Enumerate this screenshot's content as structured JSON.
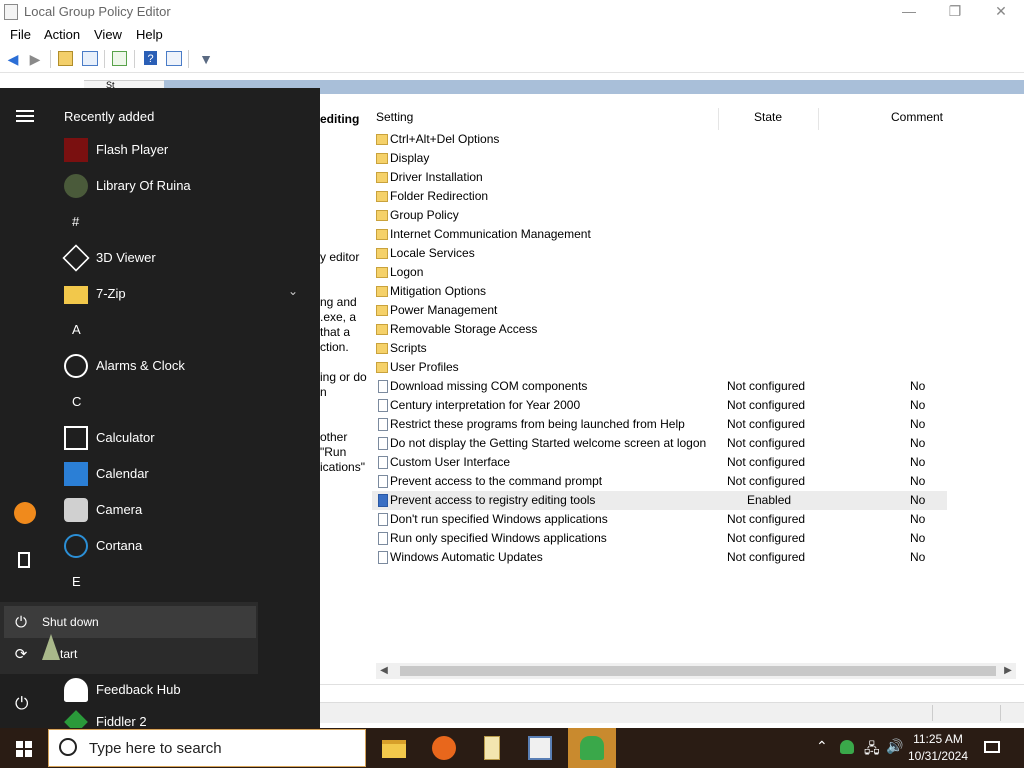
{
  "window": {
    "title": "Local Group Policy Editor",
    "minimize": "—",
    "maximize": "❐",
    "close": "✕"
  },
  "menu": [
    "File",
    "Action",
    "View",
    "Help"
  ],
  "left_pane": {
    "tree_partial": "St",
    "header_partial": "editing",
    "desc_lines": [
      "y editor",
      "ng and",
      ".exe, a",
      "that a",
      "ction.",
      "ing or do",
      "n",
      "other",
      "\"Run",
      "ications\""
    ]
  },
  "columns": {
    "setting": "Setting",
    "state": "State",
    "comment": "Comment"
  },
  "folders": [
    "Ctrl+Alt+Del Options",
    "Display",
    "Driver Installation",
    "Folder Redirection",
    "Group Policy",
    "Internet Communication Management",
    "Locale Services",
    "Logon",
    "Mitigation Options",
    "Power Management",
    "Removable Storage Access",
    "Scripts",
    "User Profiles"
  ],
  "policies": [
    {
      "name": "Download missing COM components",
      "state": "Not configured",
      "comment": "No"
    },
    {
      "name": "Century interpretation for Year 2000",
      "state": "Not configured",
      "comment": "No"
    },
    {
      "name": "Restrict these programs from being launched from Help",
      "state": "Not configured",
      "comment": "No"
    },
    {
      "name": "Do not display the Getting Started welcome screen at logon",
      "state": "Not configured",
      "comment": "No"
    },
    {
      "name": "Custom User Interface",
      "state": "Not configured",
      "comment": "No"
    },
    {
      "name": "Prevent access to the command prompt",
      "state": "Not configured",
      "comment": "No"
    },
    {
      "name": "Prevent access to registry editing tools",
      "state": "Enabled",
      "comment": "No"
    },
    {
      "name": "Don't run specified Windows applications",
      "state": "Not configured",
      "comment": "No"
    },
    {
      "name": "Run only specified Windows applications",
      "state": "Not configured",
      "comment": "No"
    },
    {
      "name": "Windows Automatic Updates",
      "state": "Not configured",
      "comment": "No"
    }
  ],
  "start_menu": {
    "recently_added": "Recently added",
    "items": [
      {
        "label": "Flash Player",
        "icon": "flash-player-icon"
      },
      {
        "label": "Library Of Ruina",
        "icon": "library-of-ruina-icon"
      },
      {
        "letter": "#"
      },
      {
        "label": "3D Viewer",
        "icon": "3d-viewer-icon"
      },
      {
        "label": "7-Zip",
        "icon": "folder-icon"
      },
      {
        "letter": "A"
      },
      {
        "label": "Alarms & Clock",
        "icon": "alarm-clock-icon"
      },
      {
        "letter": "C"
      },
      {
        "label": "Calculator",
        "icon": "calculator-icon"
      },
      {
        "label": "Calendar",
        "icon": "calendar-icon"
      },
      {
        "label": "Camera",
        "icon": "camera-icon"
      },
      {
        "label": "Cortana",
        "icon": "cortana-icon"
      },
      {
        "letter": "E"
      }
    ],
    "after_power": [
      {
        "label": "Feedback Hub",
        "icon": "feedback-hub-icon"
      },
      {
        "label": "Fiddler 2",
        "icon": "fiddler-icon"
      }
    ],
    "power_menu": {
      "shutdown": "Shut down",
      "restart": "tart"
    }
  },
  "taskbar": {
    "search_placeholder": "Type here to search",
    "time": "11:25 AM",
    "date": "10/31/2024"
  }
}
